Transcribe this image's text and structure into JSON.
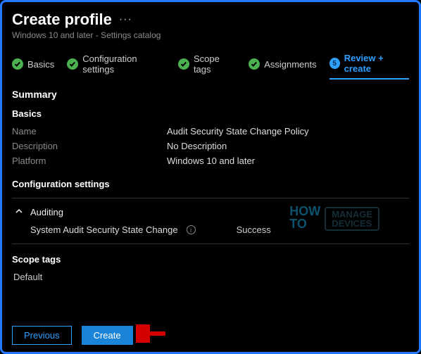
{
  "header": {
    "title": "Create profile",
    "subtitle": "Windows 10 and later - Settings catalog"
  },
  "tabs": {
    "basics": "Basics",
    "config": "Configuration settings",
    "scope": "Scope tags",
    "assign": "Assignments",
    "review": "Review + create",
    "stepNum": "5"
  },
  "summary": {
    "heading": "Summary",
    "basicsHeading": "Basics",
    "nameLabel": "Name",
    "nameValue": "Audit Security State Change Policy",
    "descLabel": "Description",
    "descValue": "No Description",
    "platLabel": "Platform",
    "platValue": "Windows 10 and later"
  },
  "configSection": {
    "heading": "Configuration settings",
    "groupName": "Auditing",
    "settingLabel": "System Audit Security State Change",
    "settingValue": "Success"
  },
  "scopeSection": {
    "heading": "Scope tags",
    "item": "Default"
  },
  "footer": {
    "prev": "Previous",
    "create": "Create"
  },
  "watermark": {
    "how": "HOW",
    "to": "TO",
    "line1": "MANAGE",
    "line2": "DEVICES"
  }
}
